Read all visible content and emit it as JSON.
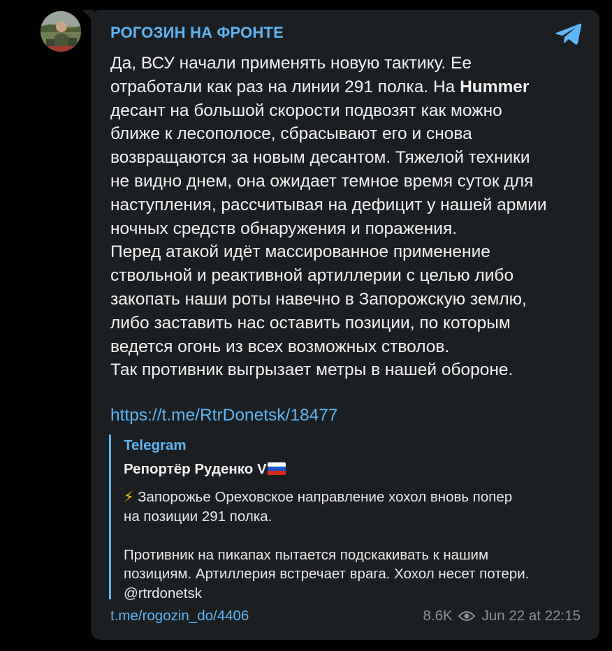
{
  "channel": {
    "name": "РОГОЗИН НА ФРОНТЕ",
    "avatar_icon": "channel-avatar-photo",
    "app_icon": "telegram-icon"
  },
  "post": {
    "lines": [
      "Да, ВСУ начали применять новую тактику. Ее",
      "отработали как раз на линии 291 полка. На ",
      "десант на большой скорости подвозят как можно",
      "ближе к лесополосе, сбрасывают его и снова",
      "возвращаются за новым десантом. Тяжелой техники",
      "не видно днем, она ожидает темное время суток для",
      "наступления, рассчитывая на дефицит у нашей армии",
      "ночных средств обнаружения и поражения.",
      "Перед атакой идёт массированное применение",
      "ствольной и реактивной артиллерии с целью либо",
      "закопать наши роты навечно в Запорожскую землю,",
      "либо заставить нас оставить позиции, по которым",
      "ведется огонь из всех возможных стволов.",
      "Так противник выгрызает метры в нашей обороне."
    ],
    "bold_word": "Hummer",
    "link": "https://t.me/RtrDonetsk/18477"
  },
  "preview": {
    "site": "Telegram",
    "title": "Репортёр Руденко V",
    "flag_icon": "russia-flag-icon",
    "bolt": "⚡",
    "desc_line1": " Запорожье Ореховское направление хохол вновь попер",
    "desc_line2": "на позиции 291 полка.",
    "desc_line3": "Противник на пикапах пытается подскакивать к нашим",
    "desc_line4": "позициям. Артиллерия встречает врага. Хохол несет потери.",
    "desc_line5": "@rtrdonetsk"
  },
  "footer": {
    "post_link": "t.me/rogozin_do/4406",
    "views": "8.6K",
    "views_icon": "eye-icon",
    "date": "Jun 22 at 22:15"
  },
  "colors": {
    "background": "#000000",
    "bubble": "#1c1f22",
    "accent": "#5eb5f7",
    "text": "#f2f2f2",
    "meta": "#8d9296"
  }
}
